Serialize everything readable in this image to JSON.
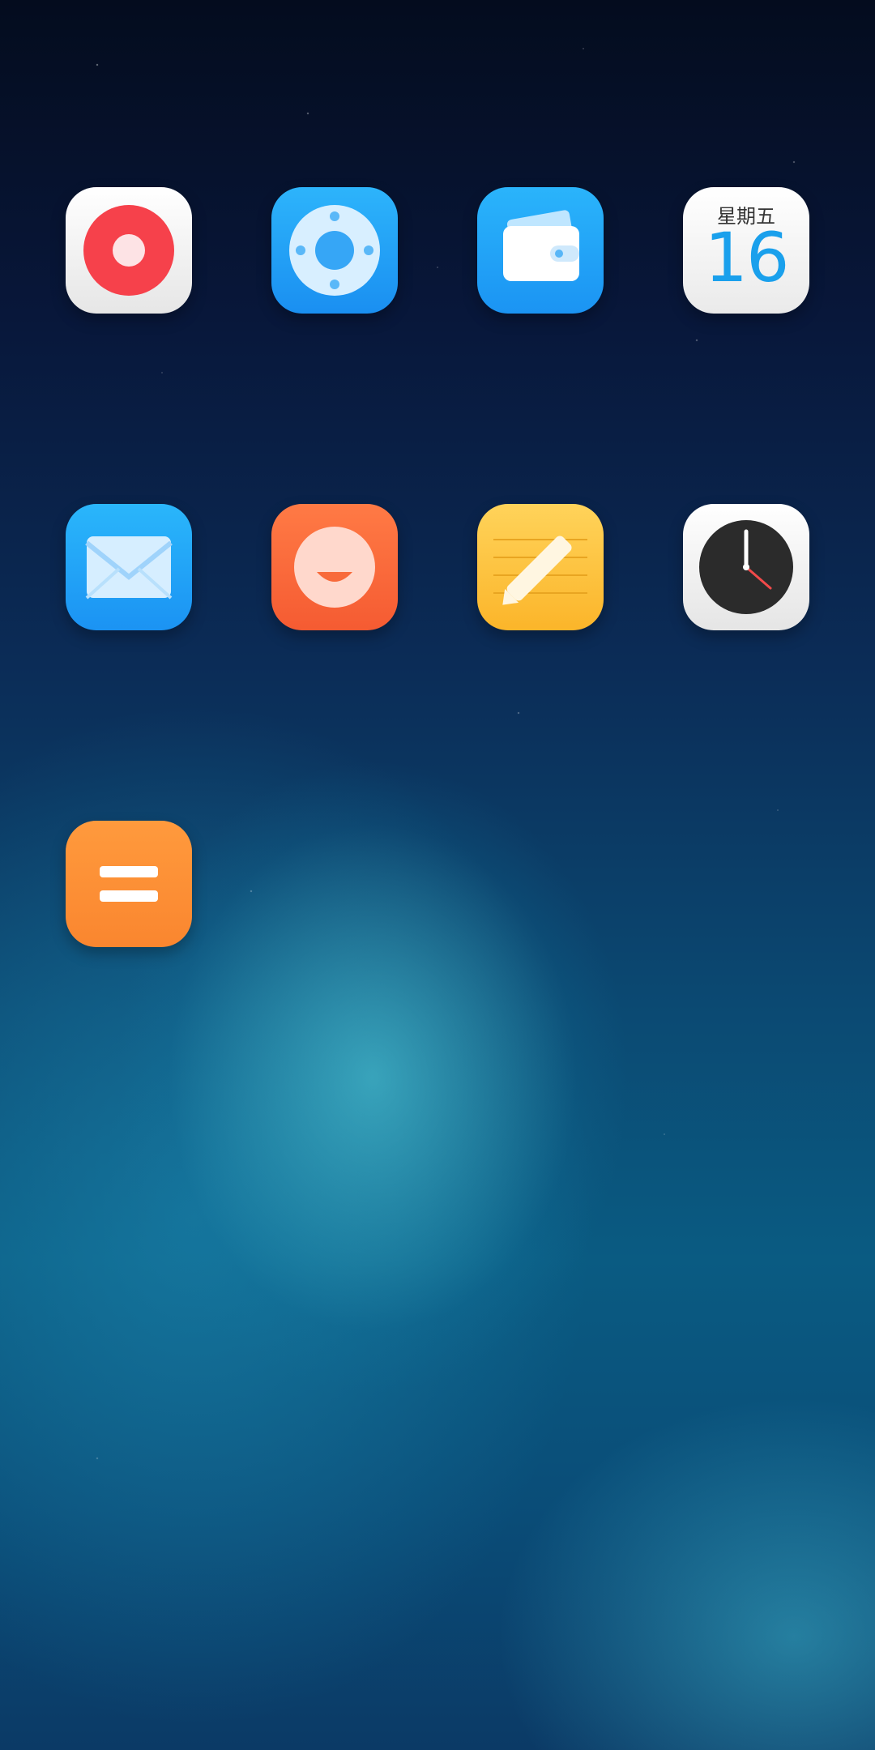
{
  "home_screen": {
    "apps": [
      {
        "id": "recorder",
        "icon": "recorder-icon",
        "color": "#f6414b"
      },
      {
        "id": "mi-home",
        "icon": "mi-home-icon",
        "color": "#1e9cf5"
      },
      {
        "id": "wallet",
        "icon": "wallet-icon",
        "color": "#1ca0f6"
      },
      {
        "id": "calendar",
        "icon": "calendar-icon",
        "weekday": "星期五",
        "day": "16",
        "color": "#1aa0ec"
      },
      {
        "id": "email",
        "icon": "mail-icon",
        "color": "#1aa1f6"
      },
      {
        "id": "feedback",
        "icon": "smile-face-icon",
        "color": "#f86a3a"
      },
      {
        "id": "notes",
        "icon": "notes-pencil-icon",
        "color": "#fcc33a"
      },
      {
        "id": "clock",
        "icon": "clock-icon",
        "color": "#2b2b2b"
      },
      {
        "id": "calculator",
        "icon": "calculator-icon",
        "color": "#fb8c35"
      }
    ]
  }
}
